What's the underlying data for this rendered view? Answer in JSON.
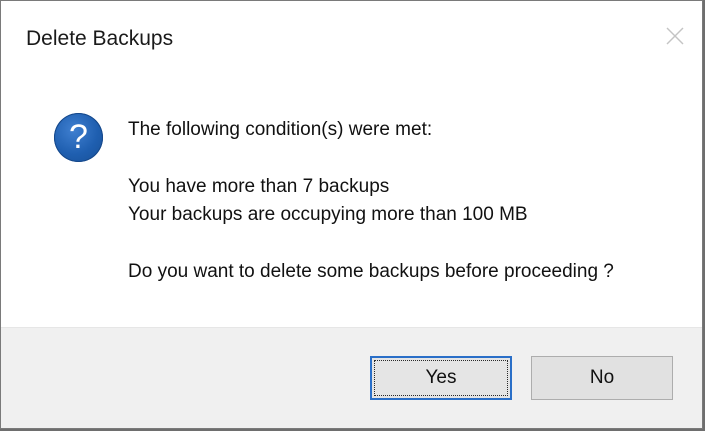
{
  "dialog": {
    "title": "Delete Backups",
    "close_icon": "close-icon",
    "icon": "question-icon",
    "question_glyph": "?",
    "message": {
      "line1": "The following condition(s) were met:",
      "line2": "You have more than 7 backups",
      "line3": "Your backups are occupying more than 100 MB",
      "line4": "Do you want to delete some backups before proceeding ?"
    },
    "buttons": {
      "yes_label": "Yes",
      "no_label": "No"
    },
    "colors": {
      "icon_blue": "#1f5fb0",
      "default_button_border": "#2a6fc8",
      "footer_bg": "#f0f0f0"
    }
  }
}
